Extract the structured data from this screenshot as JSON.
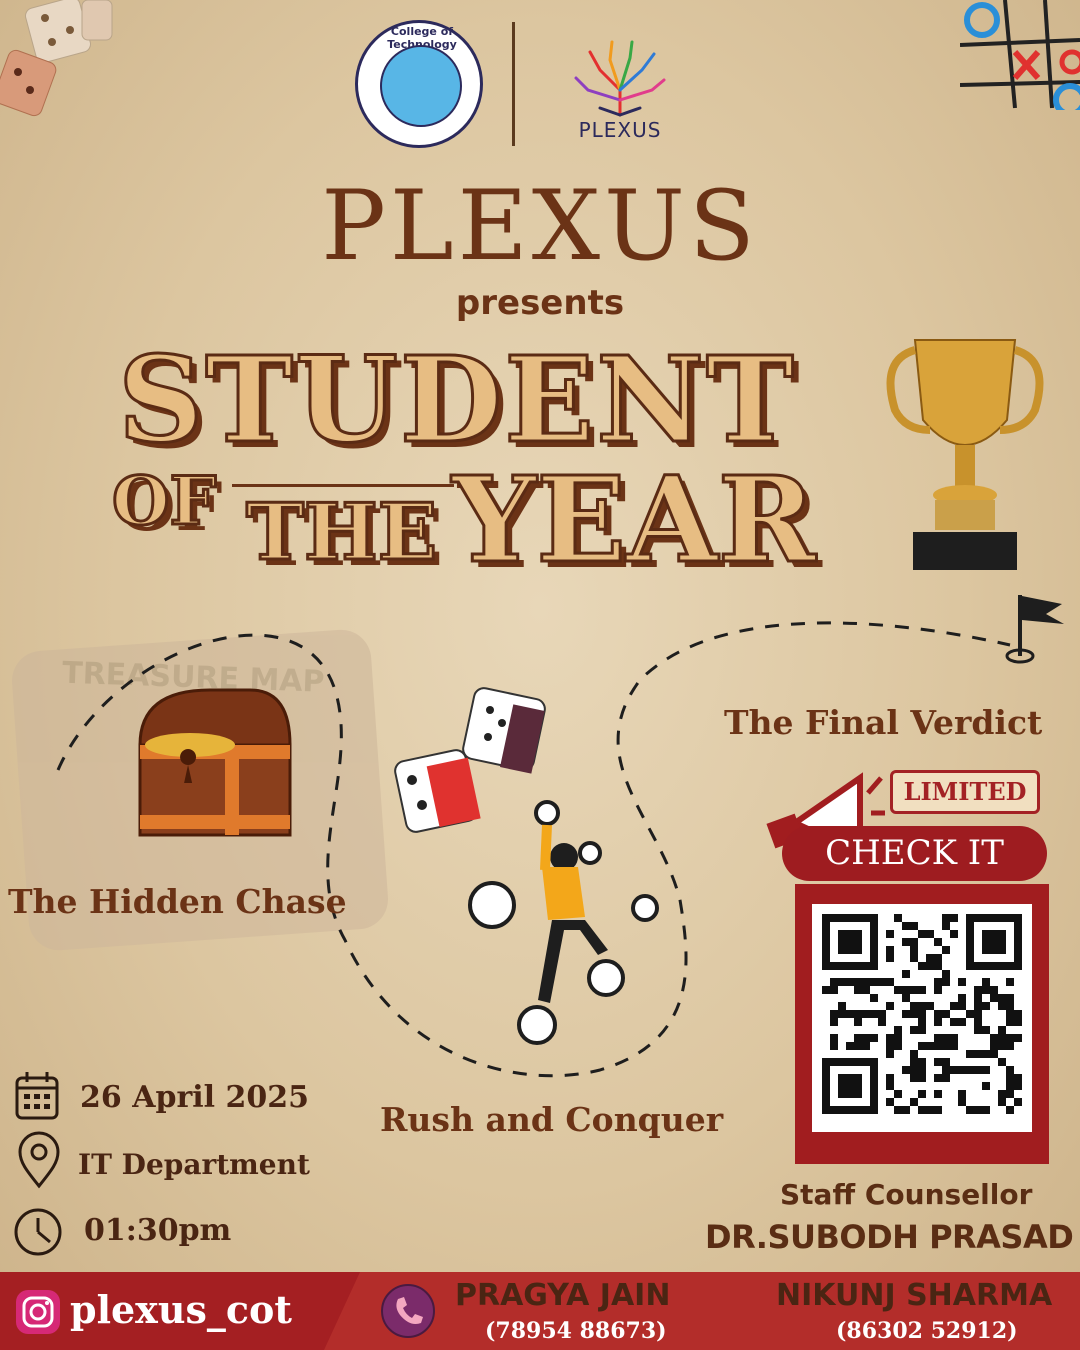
{
  "header": {
    "college_logo_text": "College of Technology",
    "plexus_logo_text": "PLEXUS",
    "title": "PLEXUS",
    "presents": "presents"
  },
  "event": {
    "word_student": "STUDENT",
    "word_of": "OF",
    "word_the": "THE",
    "word_year": "YEAR"
  },
  "map_label": "TREASURE MAP",
  "sections": {
    "hidden_chase": "The Hidden Chase",
    "rush_and_conquer": "Rush and Conquer",
    "final_verdict": "The Final Verdict"
  },
  "cta": {
    "badge": "LIMITED",
    "button": "CHECK IT"
  },
  "details": {
    "date": "26 April 2025",
    "venue": "IT Department",
    "time": "01:30pm"
  },
  "staff": {
    "label": "Staff Counsellor",
    "name": "DR.SUBODH PRASAD"
  },
  "footer": {
    "instagram": "plexus_cot",
    "contacts": [
      {
        "name": "PRAGYA JAIN",
        "phone": "(78954 88673)"
      },
      {
        "name": "NIKUNJ SHARMA",
        "phone": "(86302 52912)"
      }
    ]
  },
  "colors": {
    "background": "#dcc6a0",
    "title_brown": "#6b3316",
    "letter_fill": "#e7bd83",
    "accent_red": "#a11d1f",
    "footer_red": "#b32d2a"
  },
  "icons": [
    "dice-icon",
    "tic-tac-toe-icon",
    "trophy-icon",
    "flag-icon",
    "treasure-chest-icon",
    "climber-clocks-icon",
    "megaphone-icon",
    "qr-code",
    "calendar-icon",
    "location-icon",
    "clock-icon",
    "instagram-icon",
    "phone-icon"
  ]
}
